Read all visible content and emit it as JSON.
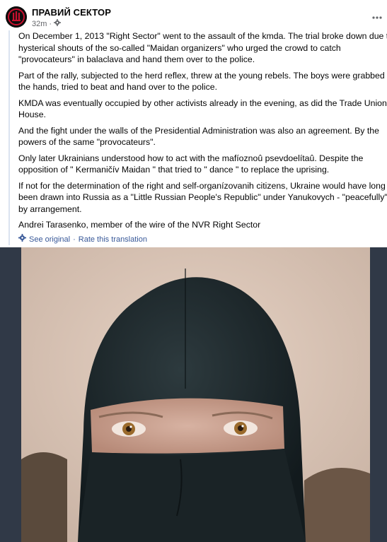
{
  "header": {
    "page_name": "ПРАВИЙ СЕКТОР",
    "timestamp": "32m",
    "privacy_icon": "settings-icon",
    "more_icon": "more-options-icon"
  },
  "post": {
    "paragraphs": [
      "On December 1, 2013 \"Right Sector\" went to the assault of the kmda. The trial broke down due to hysterical shouts of the so-called \"Maidan organizers\" who urged the crowd to catch \"provocateurs\" in balaclava and hand them over to the police.",
      "Part of the rally, subjected to the herd reflex, threw at the young rebels. The boys were grabbed by the hands, tried to beat and hand over to the police.",
      "KMDA was eventually occupied by other activists already in the evening, as did the Trade Union House.",
      "And the fight under the walls of the Presidential Administration was also an agreement. By the powers of the same \"provocateurs\".",
      "Only later Ukrainians understood how to act with the mafíoznoû psevdoelítaû. Despite the opposition of \" Kermaničív Maidan \" that tried to \" dance \" to replace the uprising.",
      "If not for the determination of the right and self-organízovanih citizens, Ukraine would have long been drawn into Russia as a \"Little Russian People's Republic\" under Yanukovych - \"peacefully\", by arrangement."
    ],
    "signature": "Andrei Tarasenko, member of the wire of the NVR Right Sector",
    "see_original": "See original",
    "separator": "·",
    "rate_translation": "Rate this translation"
  },
  "colors": {
    "link": "#385898",
    "meta": "#65676b",
    "quote_bar": "#dbe3f0"
  }
}
